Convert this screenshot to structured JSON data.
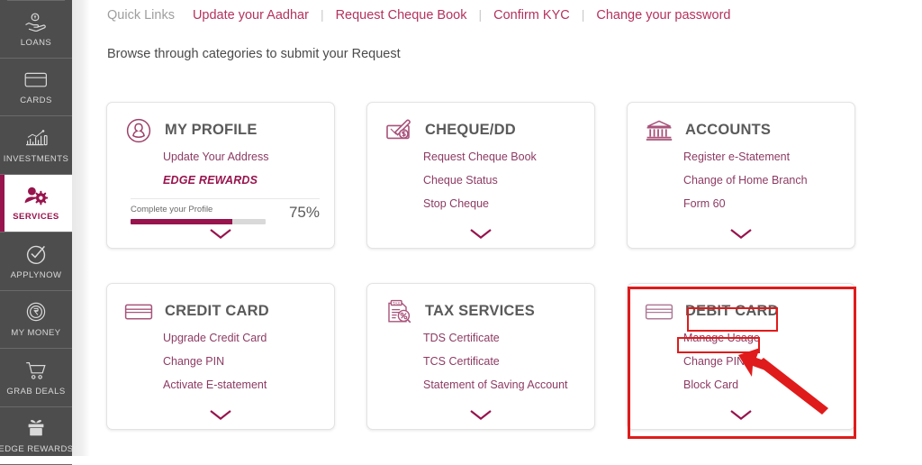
{
  "sidebar": {
    "items": [
      {
        "label": "LOANS",
        "icon": "loan-hand-icon",
        "active": false
      },
      {
        "label": "CARDS",
        "icon": "credit-card-icon",
        "active": false
      },
      {
        "label": "INVESTMENTS",
        "icon": "bar-chart-icon",
        "active": false
      },
      {
        "label": "SERVICES",
        "icon": "user-gear-icon",
        "active": true
      },
      {
        "label": "APPLYNOW",
        "icon": "check-circle-icon",
        "active": false
      },
      {
        "label": "MY MONEY",
        "icon": "rupee-coin-icon",
        "active": false
      },
      {
        "label": "GRAB DEALS",
        "icon": "shopping-cart-icon",
        "active": false
      },
      {
        "label": "EDGE REWARDS",
        "icon": "gift-box-icon",
        "active": false
      }
    ]
  },
  "quick_links": {
    "title": "Quick Links",
    "separator": "|",
    "links": [
      "Update your Aadhar",
      "Request Cheque Book",
      "Confirm KYC",
      "Change your password"
    ]
  },
  "browse_text": "Browse through categories to submit your Request",
  "cards": [
    {
      "title": "MY PROFILE",
      "icon": "profile-person-circle-icon",
      "links": [
        "Update Your Address"
      ],
      "edge_rewards_label": "EDGE REWARDS",
      "progress": {
        "label": "Complete your Profile",
        "percent_text": "75%",
        "percent_value": 75
      },
      "chevron": "chevron-down-icon",
      "highlighted": false
    },
    {
      "title": "CHEQUE/DD",
      "icon": "cheque-dollar-icon",
      "links": [
        "Request Cheque Book",
        "Cheque Status",
        "Stop Cheque"
      ],
      "chevron": "chevron-down-icon",
      "highlighted": false
    },
    {
      "title": "ACCOUNTS",
      "icon": "bank-building-icon",
      "links": [
        "Register e-Statement",
        "Change of Home Branch",
        "Form 60"
      ],
      "chevron": "chevron-down-icon",
      "highlighted": false
    },
    {
      "title": "CREDIT CARD",
      "icon": "credit-card-icon",
      "links": [
        "Upgrade Credit Card",
        "Change PIN",
        "Activate E-statement"
      ],
      "chevron": "chevron-down-icon",
      "highlighted": false
    },
    {
      "title": "TAX SERVICES",
      "icon": "tax-document-icon",
      "links": [
        "TDS Certificate",
        "TCS Certificate",
        "Statement of Saving Account"
      ],
      "chevron": "chevron-down-icon",
      "highlighted": false
    },
    {
      "title": "DEBIT CARD",
      "icon": "debit-card-icon",
      "links": [
        "Manage Usage",
        "Change PIN",
        "Block Card"
      ],
      "chevron": "chevron-down-icon",
      "highlighted": true
    }
  ],
  "annotations": {
    "outer_box_target": "DEBIT CARD",
    "title_box_target": "DEBIT CARD",
    "link_box_target": "Manage Usage",
    "arrow_points_to": "Manage Usage",
    "color": "#e01b1b"
  },
  "colors": {
    "brand_magenta": "#97144d",
    "link_magenta": "#8d3b63",
    "quicklink_magenta": "#b4325f",
    "sidebar_bg": "#4d4d4d",
    "card_title_gray": "#5a5a5a",
    "annotation_red": "#e01b1b"
  }
}
